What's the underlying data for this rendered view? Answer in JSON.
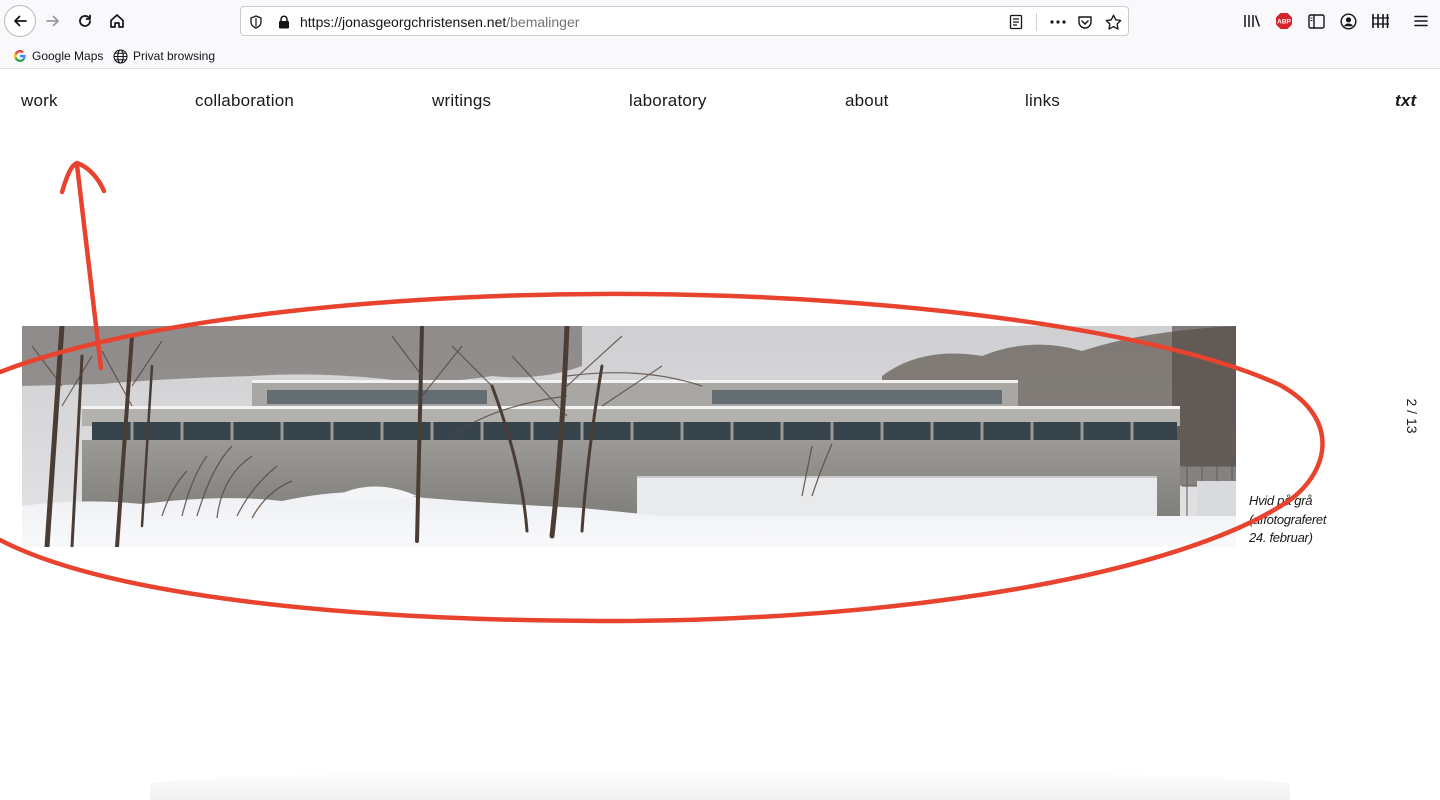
{
  "browser": {
    "url_host": "https://jonasgeorgchristensen.net",
    "url_path": "/bemalinger",
    "bookmarks": [
      {
        "label": "Google Maps",
        "icon": "google-icon"
      },
      {
        "label": "Privat browsing",
        "icon": "globe-icon"
      }
    ],
    "toolbar_icons": [
      "library-icon",
      "adblock-icon",
      "sidebar-icon",
      "account-icon",
      "extension-icon",
      "menu-icon"
    ],
    "adblock_badge": "ABP"
  },
  "site": {
    "nav": {
      "work": "work",
      "collaboration": "collaboration",
      "writings": "writings",
      "laboratory": "laboratory",
      "about": "about",
      "links": "links",
      "txt": "txt"
    },
    "caption": {
      "line1": "Hvid på grå",
      "line2": "(affotograferet",
      "line3": "24. februar)"
    },
    "counter": "2 / 13"
  },
  "colors": {
    "annotation": "#e8432e",
    "text": "#1a1a1a",
    "chrome": "#f9f9fb"
  }
}
